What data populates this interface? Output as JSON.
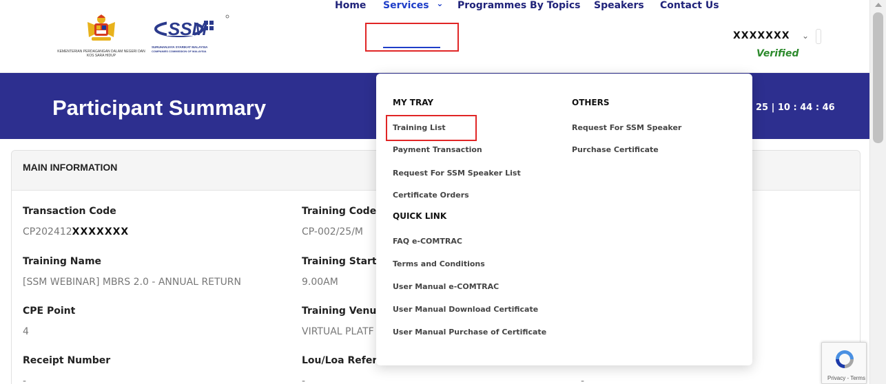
{
  "header": {
    "kpdn_text": "KEMENTERIAN PERDAGANGAN DALAM NEGERI DAN KOS SARA HIDUP",
    "ssm_subtext": "SURUHANJAYA SYARIKAT MALAYSIA",
    "ssm_subtext2": "COMPANIES COMMISSION OF MALAYSIA",
    "nav": {
      "home": "Home",
      "services": "Services",
      "services_caret": "⌄",
      "programmes": "Programmes By Topics",
      "speakers": "Speakers",
      "contact": "Contact Us"
    },
    "user": {
      "name": "XXXXXXX",
      "caret": "⌄",
      "status": "Verified"
    }
  },
  "banner": {
    "title": "Participant Summary",
    "time": "25 | 10 : 44 : 46"
  },
  "main": {
    "section_title": "MAIN INFORMATION",
    "fields": {
      "transaction_code_label": "Transaction Code",
      "transaction_code_prefix": "CP202412",
      "transaction_code_mask": "XXXXXXX",
      "training_code_label": "Training Code",
      "training_code_value": "CP-002/25/M",
      "training_name_label": "Training Name",
      "training_name_value": "[SSM WEBINAR] MBRS 2.0 - ANNUAL RETURN",
      "training_start_label": "Training Start",
      "training_start_value": "9.00AM",
      "cpe_point_label": "CPE Point",
      "cpe_point_value": "4",
      "training_venue_label": "Training Venu",
      "training_venue_value": "VIRTUAL PLATF",
      "receipt_number_label": "Receipt Number",
      "receipt_number_value": "-",
      "lou_label": "Lou/Loa Refere",
      "lou_value": "-",
      "extra_value": "-"
    }
  },
  "dropdown": {
    "my_tray_heading": "MY TRAY",
    "my_tray_items": [
      "Training List",
      "Payment Transaction",
      "Request For SSM Speaker List",
      "Certificate Orders"
    ],
    "quick_link_heading": "QUICK LINK",
    "quick_link_items": [
      "FAQ e-COMTRAC",
      "Terms and Conditions",
      "User Manual e-COMTRAC",
      "User Manual Download Certificate",
      "User Manual Purchase of Certificate"
    ],
    "others_heading": "OTHERS",
    "others_items": [
      "Request For SSM Speaker",
      "Purchase Certificate"
    ]
  },
  "recaptcha": {
    "text": "Privacy - Terms"
  },
  "colors": {
    "banner": "#2d2f8f",
    "nav_text": "#20237a",
    "nav_active": "#1e3ec8",
    "highlight_box": "#e02525",
    "verified": "#2c8a2c"
  }
}
